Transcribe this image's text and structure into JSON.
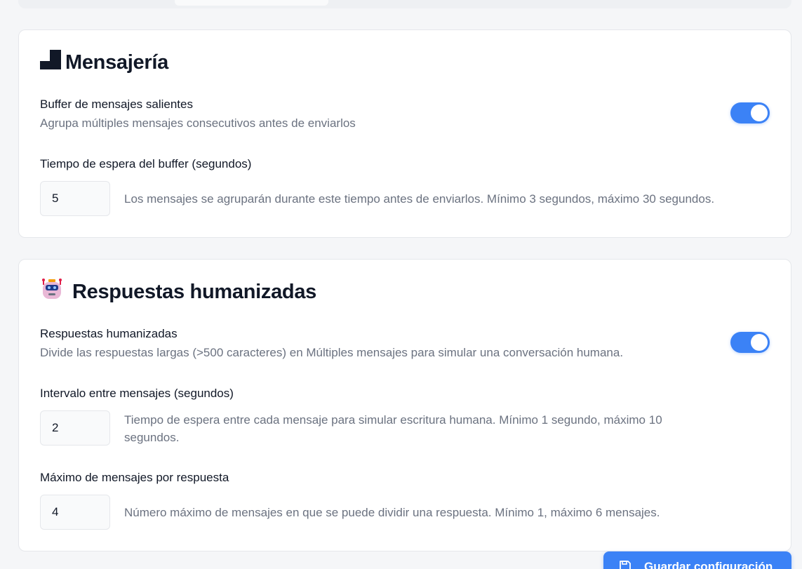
{
  "messaging": {
    "title": "Mensajería",
    "buffer_label": "Buffer de mensajes salientes",
    "buffer_desc": "Agrupa múltiples mensajes consecutivos antes de enviarlos",
    "buffer_enabled": true,
    "wait_label": "Tiempo de espera del buffer (segundos)",
    "wait_value": "5",
    "wait_hint": "Los mensajes se agruparán durante este tiempo antes de enviarlos. Mínimo 3 segundos, máximo 30 segundos."
  },
  "humanized": {
    "title": "Respuestas humanizadas",
    "toggle_label": "Respuestas humanizadas",
    "toggle_desc": "Divide las respuestas largas (>500 caracteres) en Múltiples mensajes para simular una conversación humana.",
    "enabled": true,
    "interval_label": "Intervalo entre mensajes (segundos)",
    "interval_value": "2",
    "interval_hint_line1": "Tiempo de espera entre cada mensaje para simular escritura humana. Mínimo 1 segundo, máximo 10",
    "interval_hint_line2": "segundos.",
    "max_label": "Máximo de mensajes por respuesta",
    "max_value": "4",
    "max_hint": "Número máximo de mensajes en que se puede dividir una respuesta. Mínimo 1, máximo 6 mensajes."
  },
  "actions": {
    "save_label": "Guardar configuración"
  },
  "icons": {
    "messaging": "stairs-icon",
    "humanized": "robot-icon",
    "save": "save-icon"
  },
  "colors": {
    "accent": "#3b82f6",
    "muted_text": "#6b7280"
  }
}
